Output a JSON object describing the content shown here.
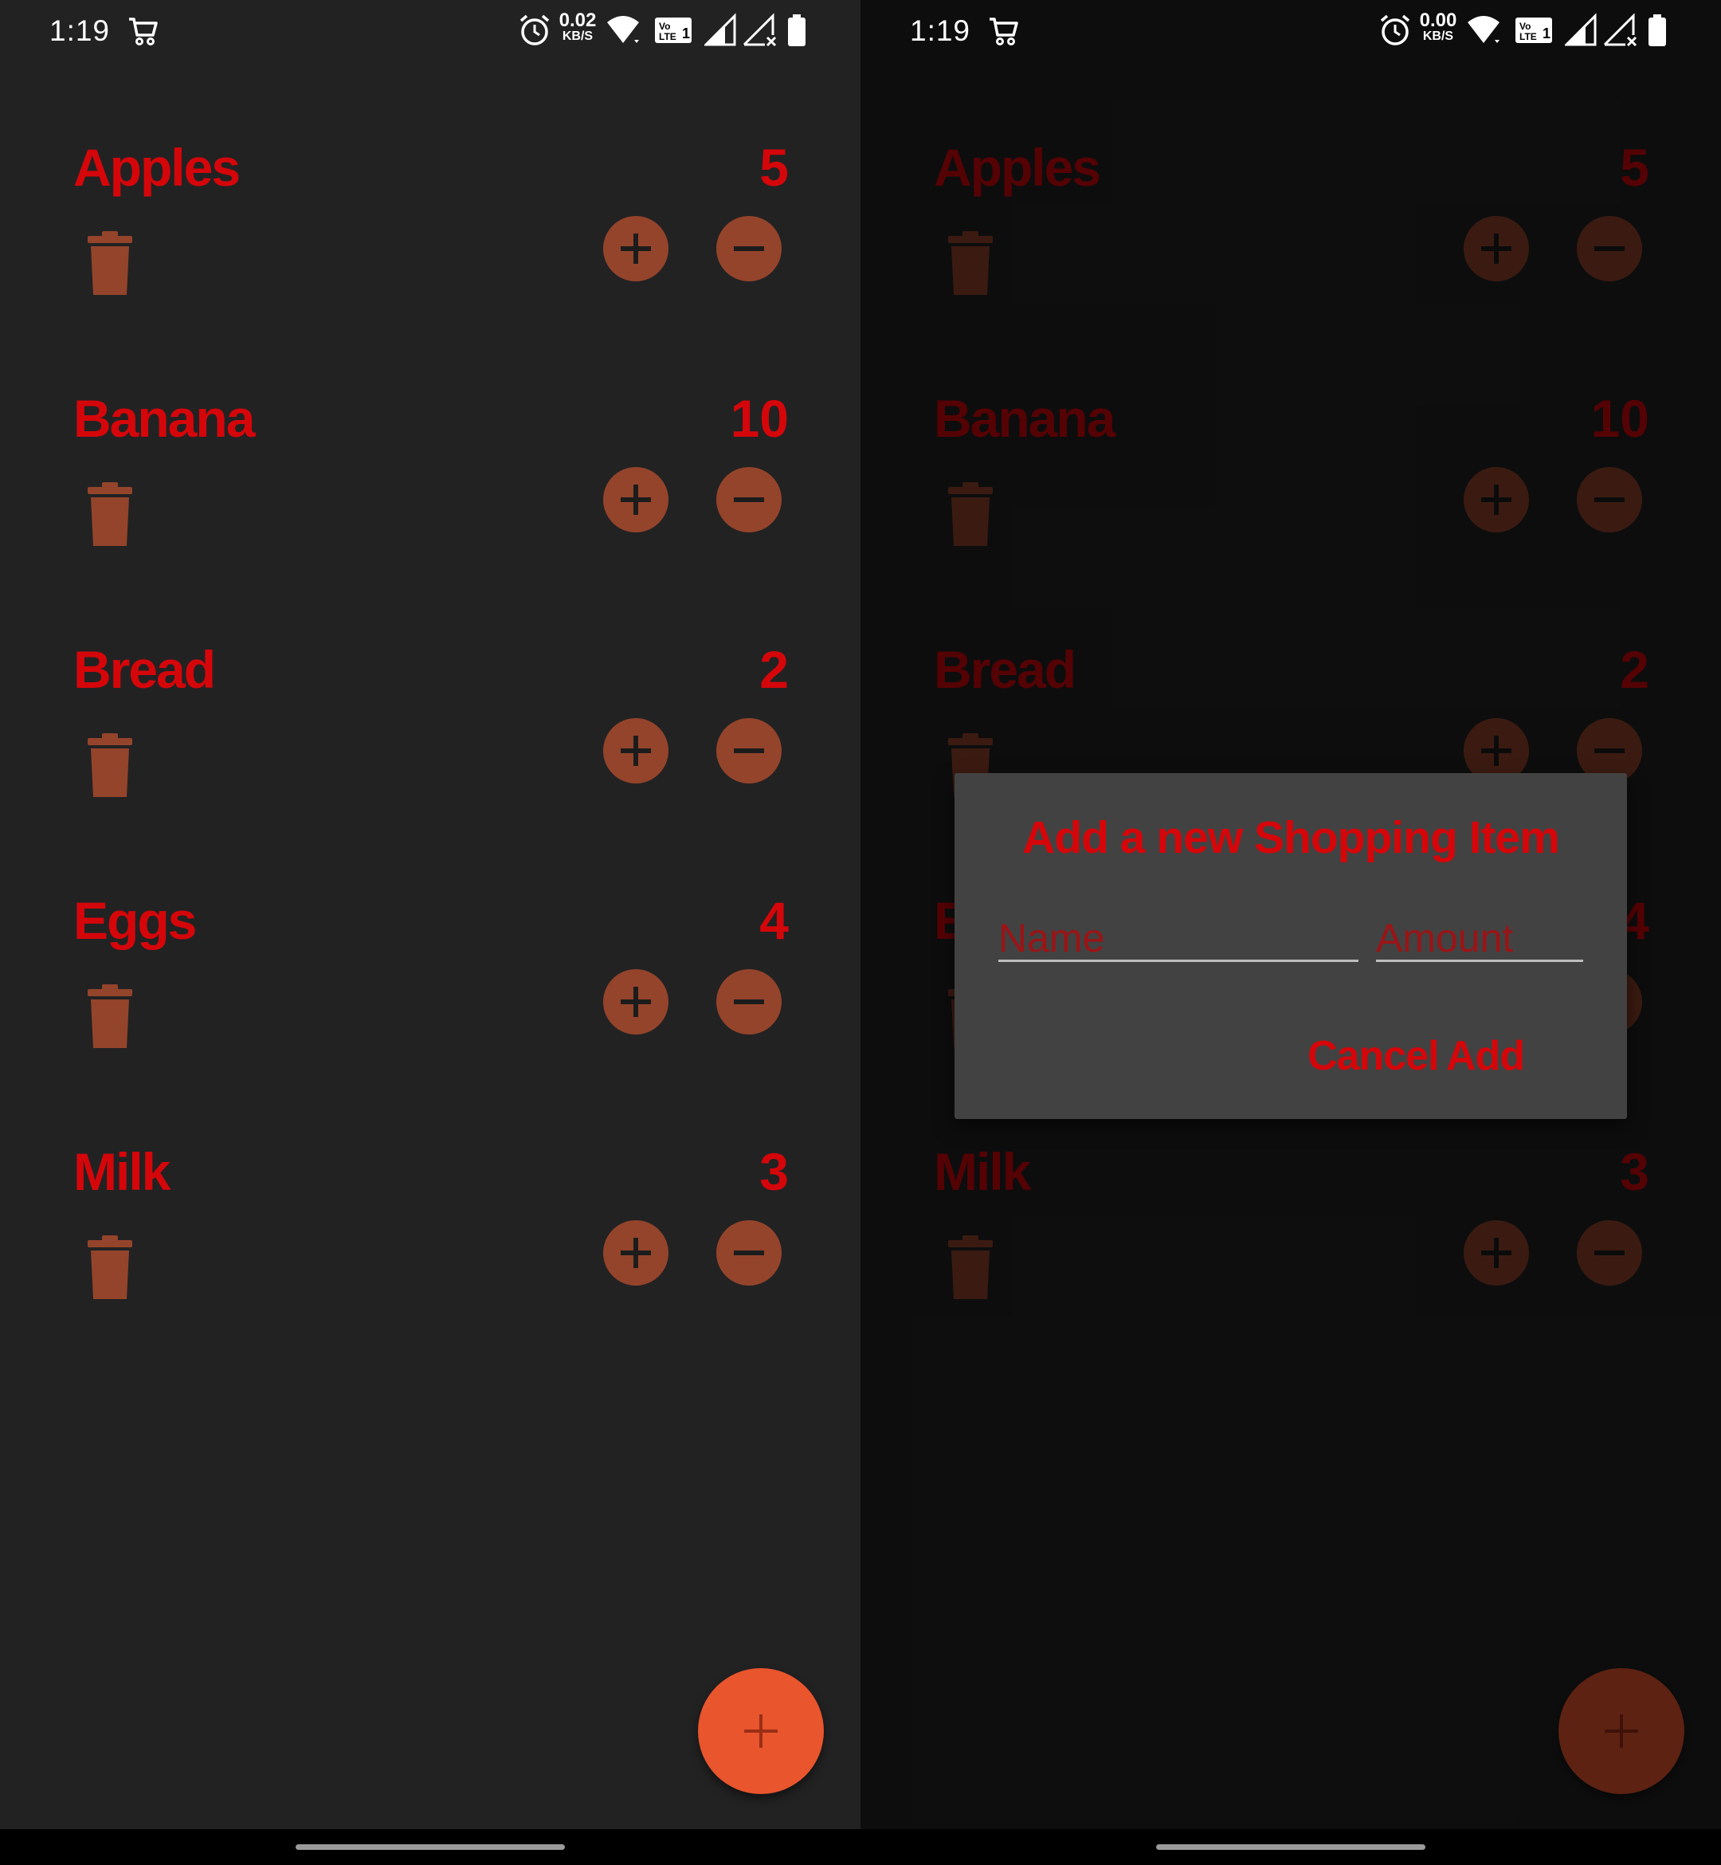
{
  "colors": {
    "background": "#222223",
    "item_text": "#d5060a",
    "icon_button": "#94442b",
    "fab": "#e9552d",
    "dialog_background": "#424242"
  },
  "left_screen": {
    "status_bar": {
      "time": "1:19",
      "data_rate": "0.02",
      "data_rate_unit": "KB/S",
      "icons": [
        "shopping-cart-icon",
        "alarm-icon",
        "wifi-icon",
        "volte-icon",
        "signal-icon",
        "signal-no-service-icon",
        "battery-icon"
      ]
    },
    "items": [
      {
        "name": "Apples",
        "amount": "5"
      },
      {
        "name": "Banana",
        "amount": "10"
      },
      {
        "name": "Bread",
        "amount": "2"
      },
      {
        "name": "Eggs",
        "amount": "4"
      },
      {
        "name": "Milk",
        "amount": "3"
      }
    ],
    "fab_icon": "plus-icon"
  },
  "right_screen": {
    "status_bar": {
      "time": "1:19",
      "data_rate": "0.00",
      "data_rate_unit": "KB/S"
    },
    "items": [
      {
        "name": "Apples",
        "amount": "5"
      },
      {
        "name": "Banana",
        "amount": "10"
      },
      {
        "name": "Bread",
        "amount": "2"
      },
      {
        "name": "Eggs",
        "amount": "4"
      },
      {
        "name": "Milk",
        "amount": "3"
      }
    ],
    "dialog": {
      "title": "Add a new Shopping Item",
      "name_placeholder": "Name",
      "amount_placeholder": "Amount",
      "cancel_label": "Cancel",
      "add_label": "Add"
    }
  }
}
